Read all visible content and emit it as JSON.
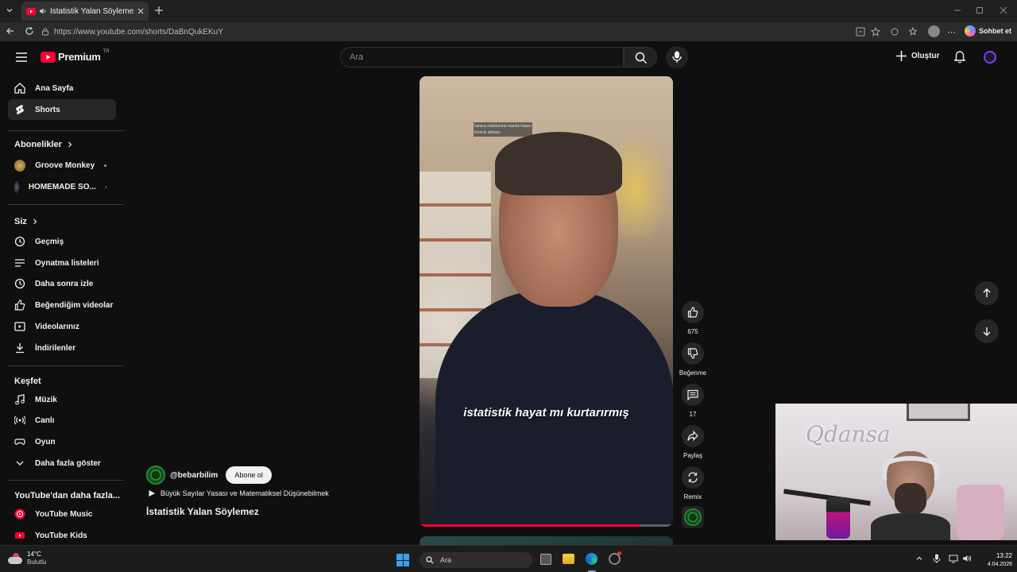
{
  "browser": {
    "tab_title": "İstatistik Yalan Söylemez - Yo",
    "url": "https://www.youtube.com/shorts/DaBnQukEKuY",
    "chat_label": "Sohbet et"
  },
  "header": {
    "logo_text": "Premium",
    "region": "TR",
    "search_placeholder": "Ara",
    "create_label": "Oluştur"
  },
  "sidebar": {
    "main": [
      {
        "label": "Ana Sayfa"
      },
      {
        "label": "Shorts"
      }
    ],
    "subs_title": "Abonelikler",
    "subscriptions": [
      {
        "label": "Groove Monkey"
      },
      {
        "label": "HOMEMADE SO..."
      }
    ],
    "you_title": "Siz",
    "you": [
      {
        "label": "Geçmiş"
      },
      {
        "label": "Oynatma listeleri"
      },
      {
        "label": "Daha sonra izle"
      },
      {
        "label": "Beğendiğim videolar"
      },
      {
        "label": "Videolarınız"
      },
      {
        "label": "İndirilenler"
      }
    ],
    "explore_title": "Keşfet",
    "explore": [
      {
        "label": "Müzik"
      },
      {
        "label": "Canlı"
      },
      {
        "label": "Oyun"
      },
      {
        "label": "Daha fazla göster"
      }
    ],
    "more_title": "YouTube'dan daha fazla...",
    "more": [
      {
        "label": "YouTube Music"
      },
      {
        "label": "YouTube Kids"
      }
    ]
  },
  "video": {
    "caption": "istatistik hayat mı kurtarırmış",
    "overlay_line1": "kalana odaklanma mantık hatası",
    "overlay_line2": "incecik akmayı",
    "progress": 0.87
  },
  "actions": {
    "likes": "675",
    "dislike_label": "Beğenme",
    "comments": "17",
    "share_label": "Paylaş",
    "remix_label": "Remix"
  },
  "channel": {
    "handle": "@bebarbilim",
    "subscribe_label": "Abone ol",
    "playlist": "Büyük Sayılar Yasası ve Matematiksel Düşünebilmek",
    "title": "İstatistik Yalan Söylemez"
  },
  "webcam": {
    "sign": "Qdansa"
  },
  "taskbar": {
    "weather_temp": "14°C",
    "weather_desc": "Bulutlu",
    "search": "Ara",
    "time": "13:22",
    "date": "4.04.2026"
  },
  "colors": {
    "accent_red": "#ff0033",
    "background": "#0f0f0f",
    "channel_green": "#2ea043"
  }
}
